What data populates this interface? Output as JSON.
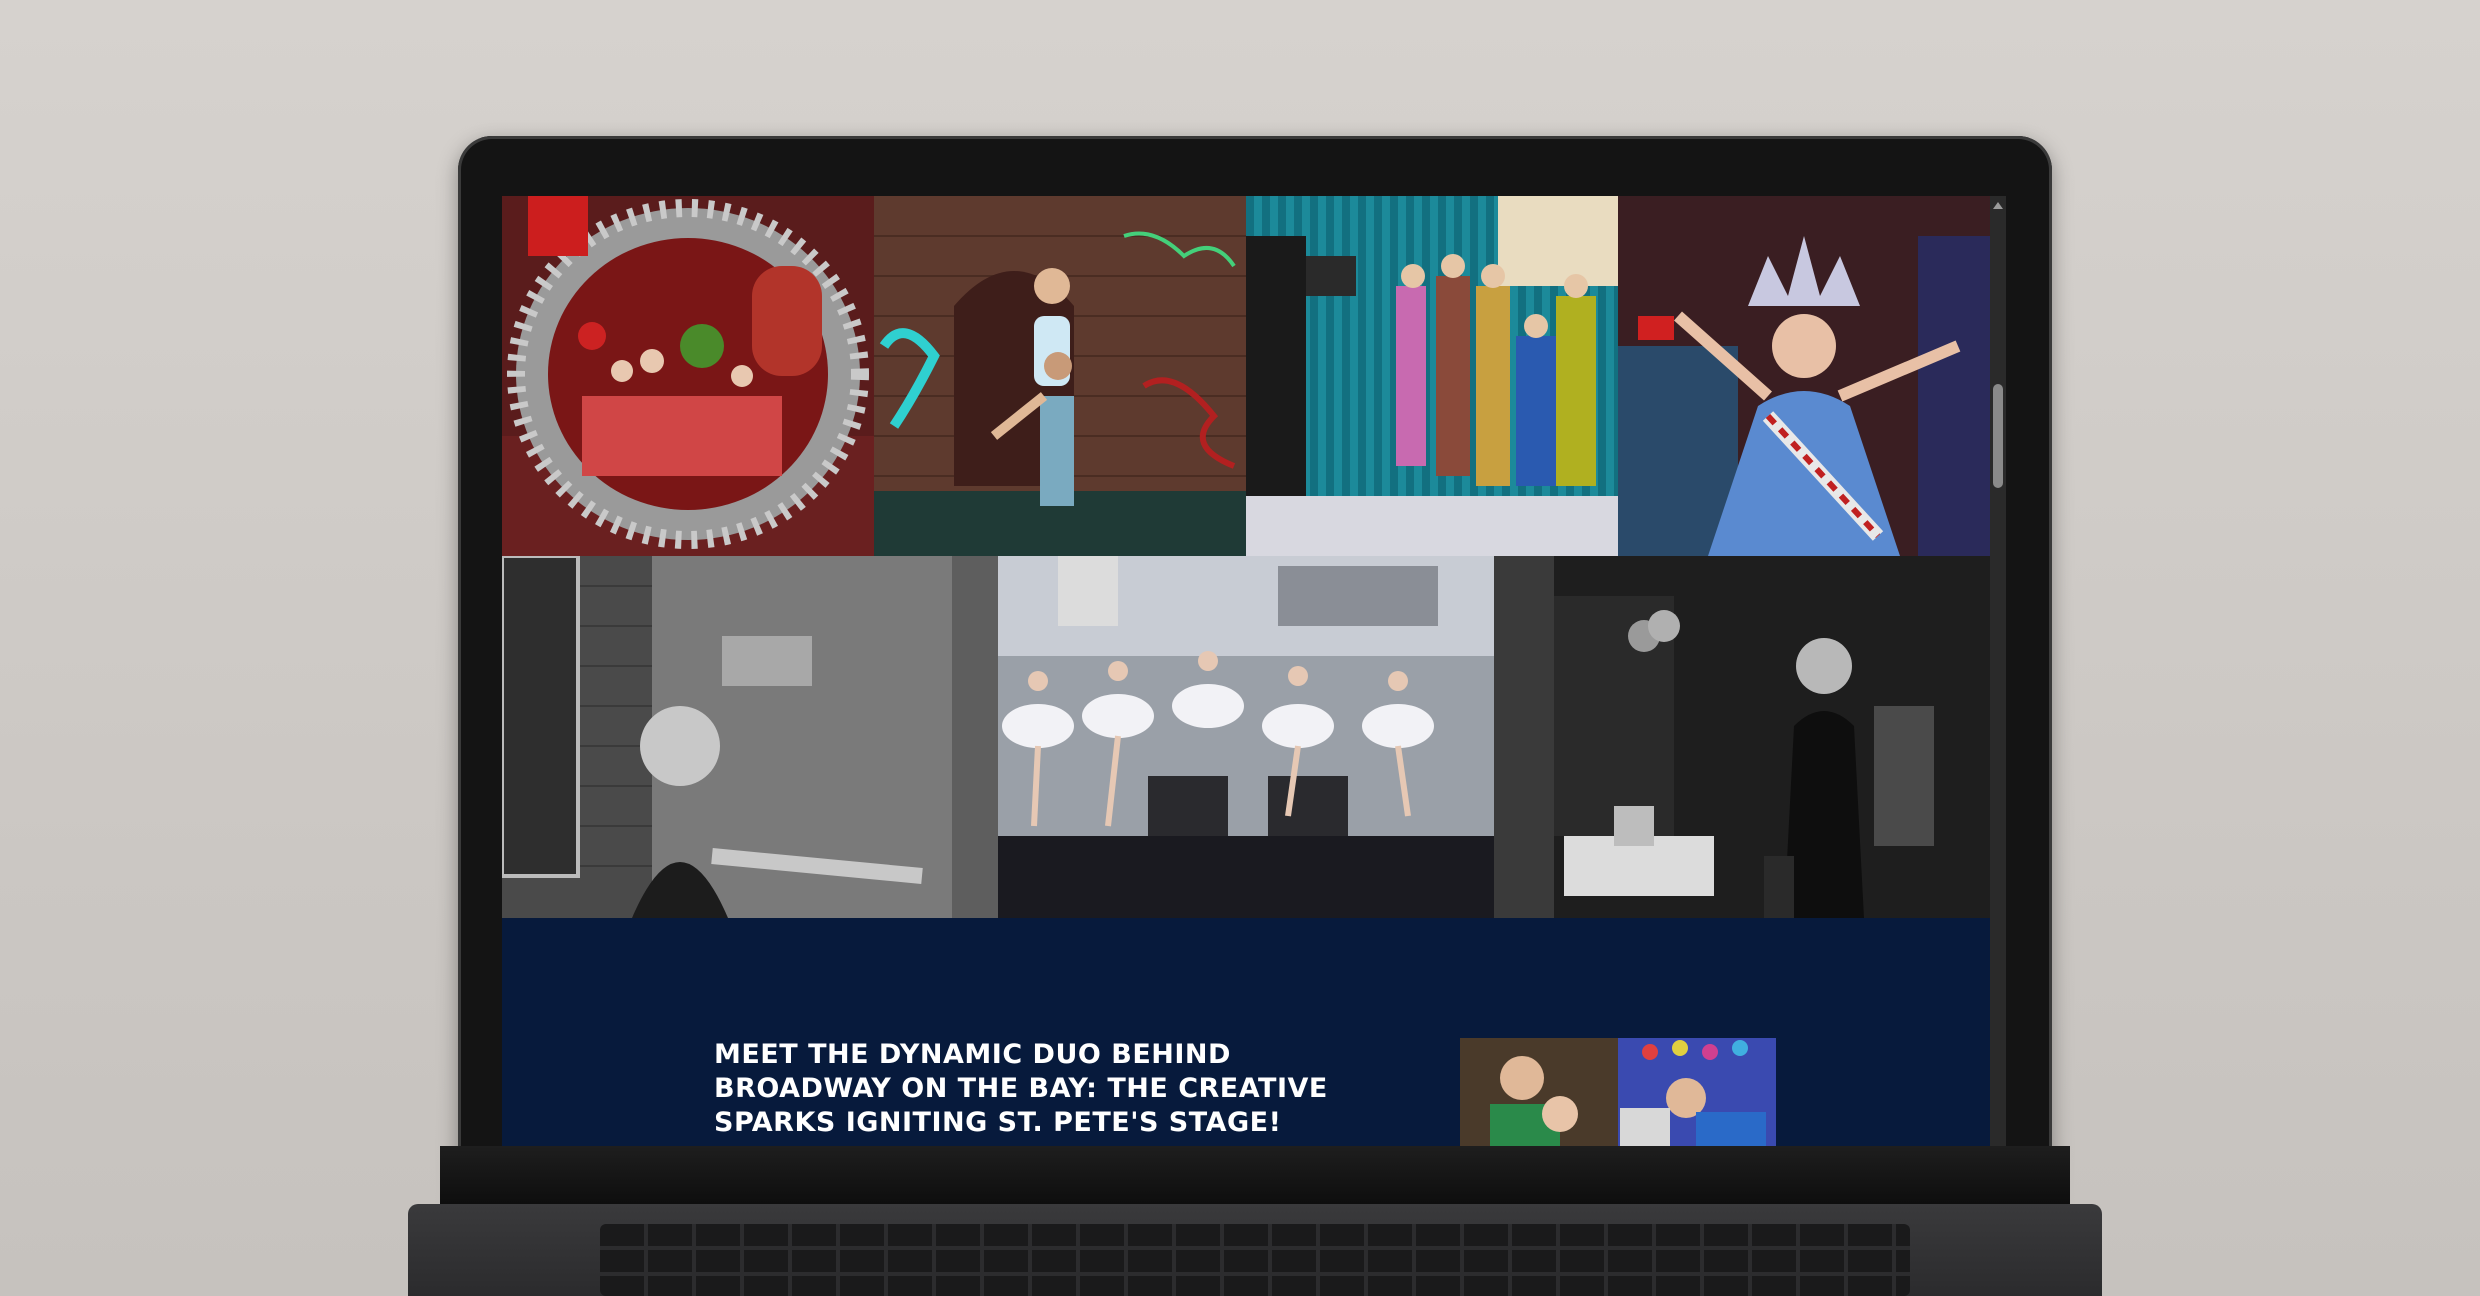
{
  "gallery": {
    "row1": [
      {
        "name": "holiday-show-photo"
      },
      {
        "name": "street-dance-photo"
      },
      {
        "name": "film-set-photo"
      },
      {
        "name": "liberty-costume-photo"
      }
    ],
    "row2": [
      {
        "name": "stage-door-photo"
      },
      {
        "name": "ballet-performance-photo"
      },
      {
        "name": "backstage-portrait-photo"
      }
    ]
  },
  "feature": {
    "title": "MEET THE DYNAMIC DUO BEHIND BROADWAY ON THE BAY: THE CREATIVE SPARKS IGNITING ST. PETE'S STAGE!",
    "thumbnail": "duo-photo"
  },
  "colors": {
    "band": "#071a3c",
    "title_text": "#ffffff"
  },
  "icons": {
    "scroll_up": "scroll-up-arrow-icon"
  }
}
